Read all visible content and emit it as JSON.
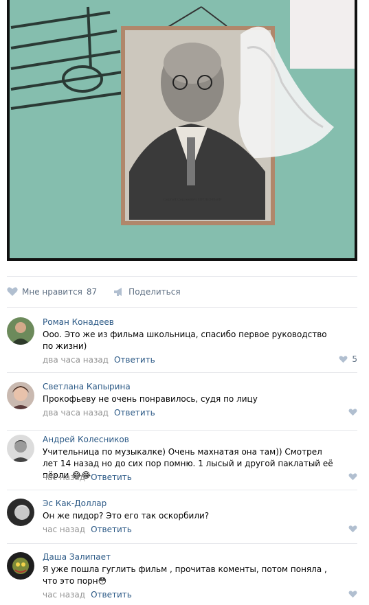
{
  "post": {
    "likes_label": "Мне нравится",
    "likes_count": "87",
    "share_label": "Поделиться"
  },
  "comments": [
    {
      "name": "Роман Конадеев",
      "text": "Ооо. Это же из фильма школьница, спасибо первое руководство по жизни)",
      "time": "два часа назад",
      "reply": "Ответить",
      "likes": "5"
    },
    {
      "name": "Светлана Капырина",
      "text": "Прокофьеву не очень понравилось, судя по лицу",
      "time": "два часа назад",
      "reply": "Ответить",
      "likes": ""
    },
    {
      "name": "Андрей Колесников",
      "text": "Учительница по музыкалке) Очень махнатая она там)) Смотрел лет 14 назад но до сих пор помню. 1 лысый и другой паклатый её пёрли 😂😂",
      "time": "час назад",
      "reply": "Ответить",
      "likes": ""
    },
    {
      "name": "Эс Как-Доллар",
      "text": "Он же пидор? Это его так оскорбили?",
      "time": "час назад",
      "reply": "Ответить",
      "likes": ""
    },
    {
      "name": "Даша Залипает",
      "text": "Я уже пошла гуглить фильм , прочитав коменты, потом поняла , что это порн😳",
      "time": "час назад",
      "reply": "Ответить",
      "likes": ""
    }
  ],
  "portrait_caption": "Сергей Сергеевич ПРОКОФЬЕВ",
  "colors": {
    "link": "#2a5885",
    "meta": "#939393",
    "action": "#5d6e82"
  }
}
